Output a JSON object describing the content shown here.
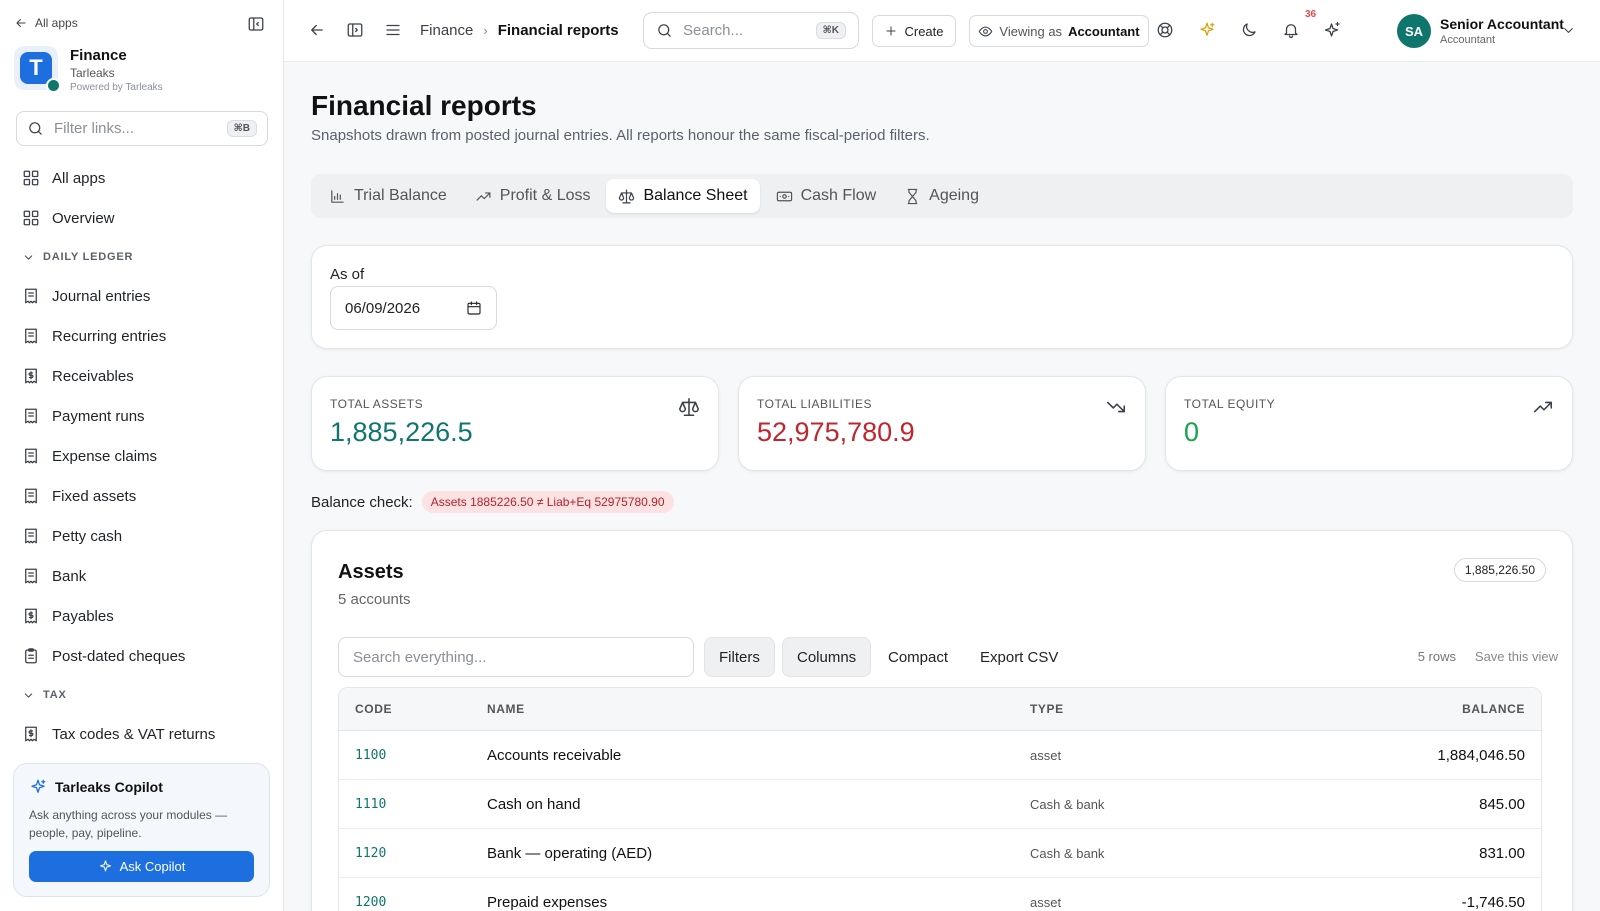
{
  "sidebar": {
    "all_apps_link": "All apps",
    "brand": {
      "name": "Finance",
      "org": "Tarleaks",
      "powered": "Powered by Tarleaks",
      "logo_letter": "T"
    },
    "filter": {
      "placeholder": "Filter links...",
      "shortcut": "⌘B"
    },
    "top_items": [
      {
        "label": "All apps",
        "icon": "grid-icon"
      },
      {
        "label": "Overview",
        "icon": "grid-icon"
      }
    ],
    "sections": [
      {
        "title": "DAILY LEDGER",
        "items": [
          {
            "label": "Journal entries",
            "icon": "receipt-icon"
          },
          {
            "label": "Recurring entries",
            "icon": "receipt-icon"
          },
          {
            "label": "Receivables",
            "icon": "receipt-dollar-icon"
          },
          {
            "label": "Payment runs",
            "icon": "receipt-icon"
          },
          {
            "label": "Expense claims",
            "icon": "receipt-icon"
          },
          {
            "label": "Fixed assets",
            "icon": "receipt-icon"
          },
          {
            "label": "Petty cash",
            "icon": "receipt-icon"
          },
          {
            "label": "Bank",
            "icon": "receipt-icon"
          },
          {
            "label": "Payables",
            "icon": "receipt-dollar-icon"
          },
          {
            "label": "Post-dated cheques",
            "icon": "clipboard-icon"
          }
        ]
      },
      {
        "title": "TAX",
        "items": [
          {
            "label": "Tax codes & VAT returns",
            "icon": "receipt-dollar-icon"
          }
        ]
      }
    ],
    "copilot": {
      "title": "Tarleaks Copilot",
      "text": "Ask anything across your modules — people, pay, pipeline.",
      "button": "Ask Copilot"
    }
  },
  "topbar": {
    "breadcrumb": [
      "Finance",
      "Financial reports"
    ],
    "search": {
      "placeholder": "Search...",
      "shortcut": "⌘K"
    },
    "create_label": "Create",
    "viewing_as_prefix": "Viewing as",
    "viewing_as_role": "Accountant",
    "notification_count": "36",
    "user": {
      "initials": "SA",
      "name": "Senior Accountant",
      "role": "Accountant"
    }
  },
  "page": {
    "title": "Financial reports",
    "subtitle": "Snapshots drawn from posted journal entries. All reports honour the same fiscal-period filters.",
    "tabs": [
      {
        "label": "Trial Balance",
        "icon": "bar-chart-icon",
        "active": false
      },
      {
        "label": "Profit & Loss",
        "icon": "trend-up-icon",
        "active": false
      },
      {
        "label": "Balance Sheet",
        "icon": "scale-icon",
        "active": true
      },
      {
        "label": "Cash Flow",
        "icon": "banknote-icon",
        "active": false
      },
      {
        "label": "Ageing",
        "icon": "hourglass-icon",
        "active": false
      }
    ],
    "as_of": {
      "label": "As of",
      "value": "06/09/2026"
    },
    "kpis": [
      {
        "label": "TOTAL ASSETS",
        "value": "1,885,226.5",
        "color": "#0f766e",
        "icon": "scale-icon"
      },
      {
        "label": "TOTAL LIABILITIES",
        "value": "52,975,780.9",
        "color": "#c0262d",
        "icon": "trend-down-icon"
      },
      {
        "label": "TOTAL EQUITY",
        "value": "0",
        "color": "#16a34a",
        "icon": "trend-up-icon"
      }
    ],
    "balance_check": {
      "label": "Balance check:",
      "status": "Assets 1885226.50 ≠ Liab+Eq 52975780.90"
    },
    "assets": {
      "title": "Assets",
      "count": "5 accounts",
      "total": "1,885,226.50",
      "search_placeholder": "Search everything...",
      "buttons": {
        "filters": "Filters",
        "columns": "Columns",
        "compact": "Compact",
        "export": "Export CSV"
      },
      "rows_count": "5 rows",
      "save_view": "Save this view",
      "columns": [
        "CODE",
        "NAME",
        "TYPE",
        "BALANCE"
      ],
      "rows": [
        {
          "code": "1100",
          "name": "Accounts receivable",
          "type": "asset",
          "balance": "1,884,046.50"
        },
        {
          "code": "1110",
          "name": "Cash on hand",
          "type": "Cash & bank",
          "balance": "845.00"
        },
        {
          "code": "1120",
          "name": "Bank — operating (AED)",
          "type": "Cash & bank",
          "balance": "831.00"
        },
        {
          "code": "1200",
          "name": "Prepaid expenses",
          "type": "asset",
          "balance": "-1,746.50"
        }
      ]
    }
  }
}
